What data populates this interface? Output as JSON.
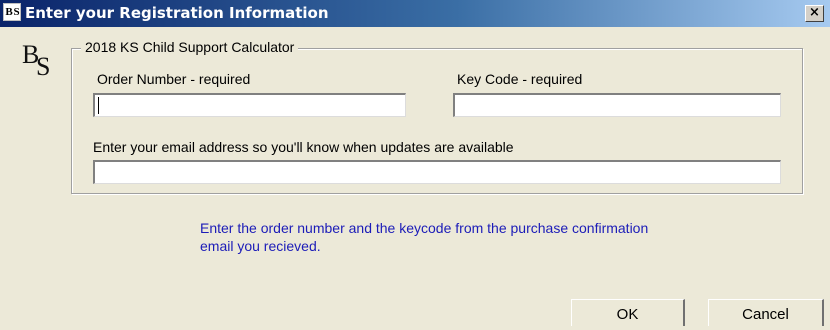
{
  "window": {
    "title": "Enter your Registration Information",
    "icon_text": "B S",
    "close_label": "×"
  },
  "logo": {
    "letter_b": "B",
    "letter_s": "S"
  },
  "group": {
    "legend": "2018 KS Child Support Calculator",
    "order_number_label": "Order Number - required",
    "order_number_value": "",
    "key_code_label": "Key Code - required",
    "key_code_value": "",
    "email_label": "Enter your email address so you'll know when updates are available",
    "email_value": ""
  },
  "info": {
    "line1": "Enter the order number and the keycode from the purchase confirmation",
    "line2": "email you recieved."
  },
  "buttons": {
    "ok_label": "OK",
    "cancel_label": "Cancel"
  },
  "colors": {
    "title_bar_start": "#0a246a",
    "title_bar_end": "#a6caf0",
    "dialog_bg": "#ece9d8",
    "info_text": "#1c1cb8"
  }
}
